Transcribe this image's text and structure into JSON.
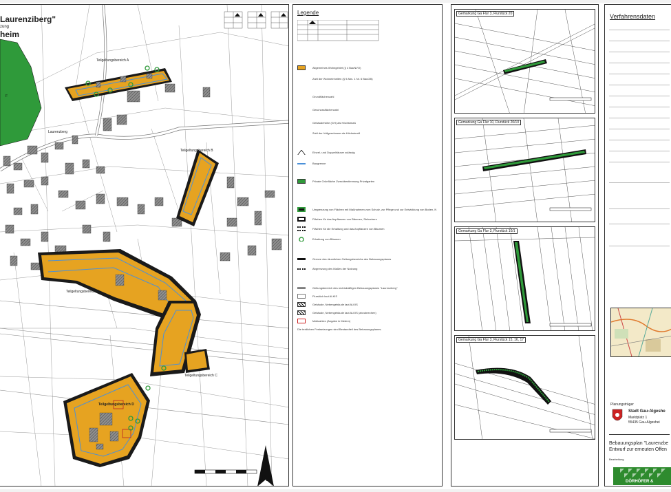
{
  "map": {
    "title_line1": "Laurenziberg\"",
    "title_line2": "zung",
    "title_line3": "heim",
    "areas": {
      "a": "Teilgeltungsbereich A",
      "b": "Teilgeltungsbereich B",
      "c": "Teilgeltungsbereich C",
      "d": "Teilgeltungsbereich D",
      "e": "Teilgeltungsbereich E"
    },
    "street": "Laurenzberg",
    "north": "N"
  },
  "legend": {
    "title": "Legende",
    "rows": [
      "Allgemeines Wohngebiet (§ 4 BauNVO)",
      "Zahl der Wohneinheiten (§ 9 Abs. 1 Nr. 6 BauGB)",
      "Grundflächenzahl",
      "Geschossflächenzahl",
      "Gebäudehöhe (GH) als Höchstmaß",
      "Zahl der Vollgeschosse als Höchstmaß",
      "Einzel- und Doppelhäuser zulässig",
      "Baugrenze",
      "Private Grünfläche Zweckbestimmung Privatgarten",
      "Umgrenzung von Flächen mit Maßnahmen zum Schutz, zur Pflege und zur Entwicklung von Boden, Natur und Landschaft",
      "Flächen für das Anpflanzen von Bäumen, Sträuchern",
      "Flächen für die Erhaltung und das Anpflanzen von Bäumen",
      "Erhaltung von Bäumen",
      "Grenze des räumlichen Geltungsbereichs des Bebauungsplanes",
      "Abgrenzung des Maßes der Nutzung",
      "Geltungsbereich des rechtskräftigen Bebauungsplanes \"Laurenzberg\"",
      "Flurstück laut ALKIS",
      "Gebäude, Nebengebäude laut ALKIS",
      "Gebäude, Nebengebäude laut ALKIS (abzubrechen)",
      "Maßzahlen (Angabe in Metern)",
      "Die textlichen Festsetzungen sind Bestandteil des Bebauungsplanes."
    ]
  },
  "details": [
    "Gemarkung Ga Flur 3, Flurstück 20",
    "Gemarkung Ga Flur 10, Flurstück 20/10",
    "Gemarkung Ga Flur 3, Flurstück 10/1",
    "Gemarkung Ga Flur 3, Flurstück 15, 16, 17"
  ],
  "procedure": {
    "title": "Verfahrensdaten",
    "owner_label": "Planungsträger",
    "city": "Stadt Gau-Algeshe",
    "street": "Marktplatz 1",
    "zip": "55435 Gau-Algeshei",
    "plan_line1": "Bebauungsplan \"Laurenzbe",
    "plan_line2": "Entwurf zur erneuten Offen",
    "processing": "Bearbeitung",
    "company": "DÖRHÖFER &"
  },
  "colors": {
    "plot_orange": "#e6a321",
    "green": "#2f9a3a",
    "boundary": "#1a1a1a",
    "blue_line": "#4a90d9"
  }
}
